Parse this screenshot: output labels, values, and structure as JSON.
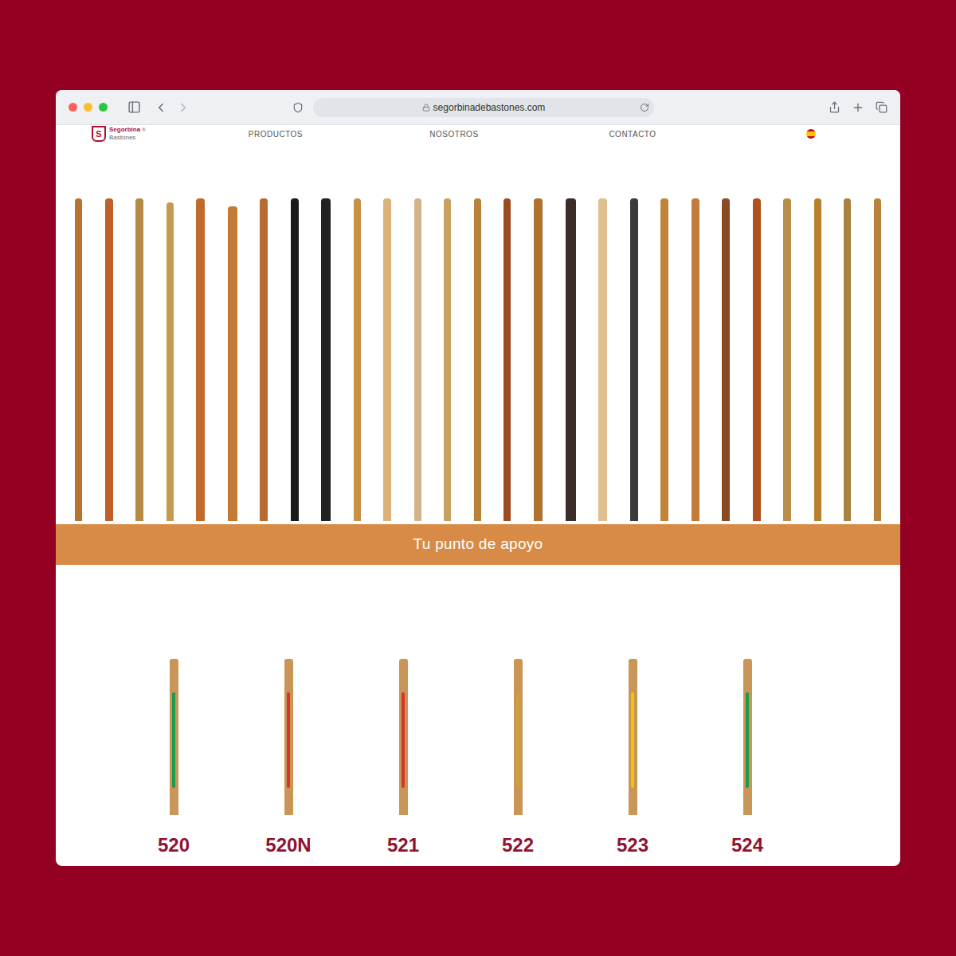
{
  "browser": {
    "url": "segorbinadebastones.com"
  },
  "nav": {
    "logo": {
      "letter": "S",
      "name": "Segorbina",
      "mark": "®",
      "sub": "Bastones"
    },
    "items": [
      {
        "label": "PRODUCTOS"
      },
      {
        "label": "NOSOTROS"
      },
      {
        "label": "CONTACTO"
      }
    ]
  },
  "banner": {
    "text": "Tu punto de apoyo"
  },
  "products": [
    {
      "code": "520",
      "color": "#1f9a4a"
    },
    {
      "code": "520N",
      "color": "#d8342c"
    },
    {
      "code": "521",
      "color": "#d8342c"
    },
    {
      "code": "522",
      "color": "#c9a23a"
    },
    {
      "code": "523",
      "color": "#f2c400"
    },
    {
      "code": "524",
      "color": "#1f9a4a"
    }
  ]
}
